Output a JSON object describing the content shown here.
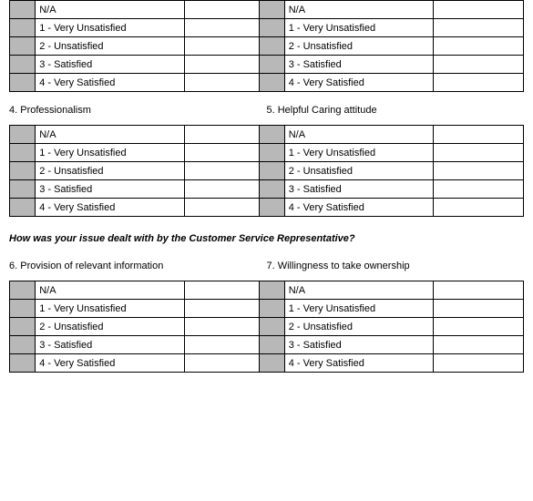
{
  "scale": {
    "options": [
      "N/A",
      "1 - Very Unsatisfied",
      "2 - Unsatisfied",
      "3 - Satisfied",
      "4 - Very Satisfied"
    ]
  },
  "questions": {
    "q4": "4. Professionalism",
    "q5": "5. Helpful Caring attitude",
    "q6": "6. Provision of relevant information",
    "q7": "7. Willingness to take ownership"
  },
  "section_heading": "How was your issue dealt with by the Customer Service Representative?"
}
